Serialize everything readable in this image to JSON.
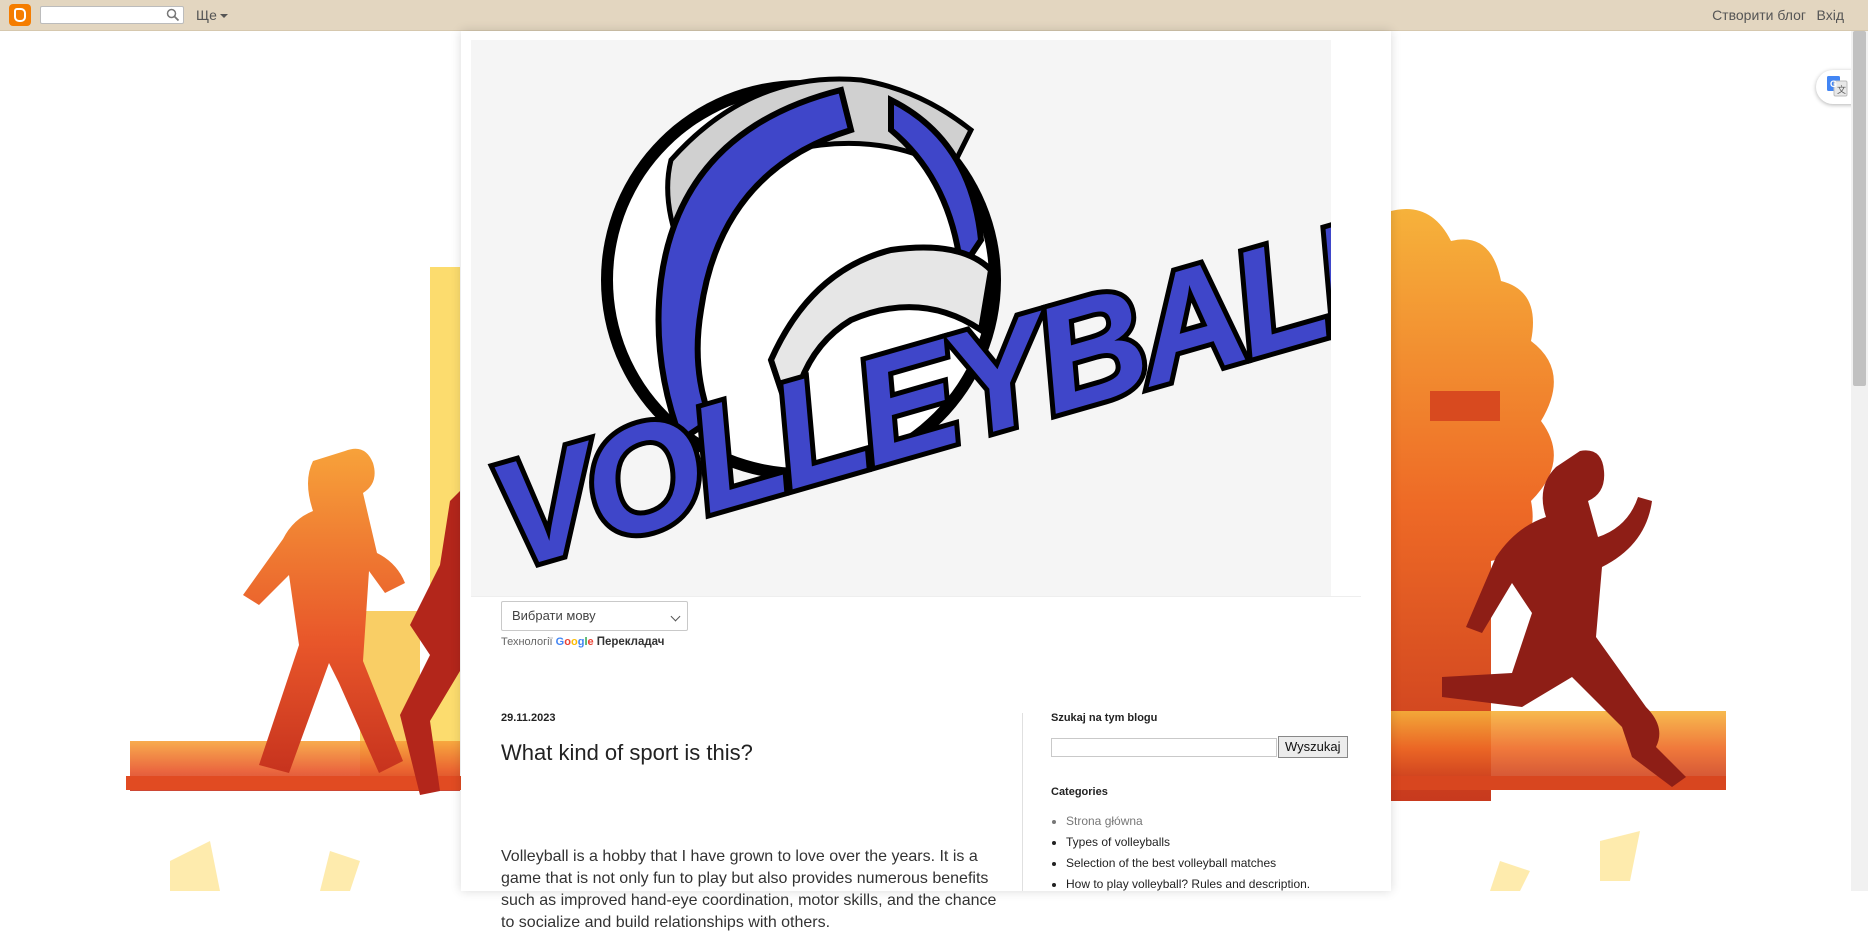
{
  "navbar": {
    "search_value": "",
    "more_label": "Ще",
    "create_blog_label": "Створити блог",
    "login_label": "Вхід"
  },
  "header": {
    "logo_text": "VOLLEYBALL"
  },
  "translate": {
    "select_value": "Вибрати мову",
    "powered_by": "Технології",
    "google": "Google",
    "translator": "Перекладач"
  },
  "post": {
    "date": "29.11.2023",
    "title": "What kind of sport is this?",
    "body": "Volleyball is a hobby that I have grown to love over the years. It is a game that is not only fun to play but also provides numerous benefits such as improved hand-eye coordination, motor skills, and the chance to socialize and build relationships with others."
  },
  "sidebar": {
    "search_heading": "Szukaj na tym blogu",
    "search_button": "Wyszukaj",
    "categories_heading": "Categories",
    "categories": [
      "Strona główna",
      "Types of volleyballs",
      "Selection of the best volleyball matches",
      "How to play volleyball? Rules and description."
    ]
  },
  "colors": {
    "navbar_bg": "#e3d6c0",
    "blogger_orange": "#f57d00",
    "ball_blue": "#3f46c9"
  },
  "icons": [
    "blogger-logo-icon",
    "search-icon",
    "chevron-down-icon",
    "google-translate-icon"
  ]
}
